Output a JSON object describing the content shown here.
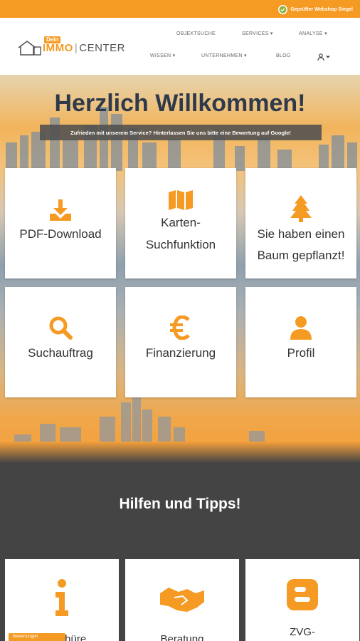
{
  "topbar": {
    "seal_label": "Geprüfter Webshop Siegel"
  },
  "logo": {
    "dein": "Dein",
    "immo": "IMMO",
    "center": "CENTER"
  },
  "nav": {
    "objektsuche": "OBJEKTSUCHE",
    "services": "SERVICES",
    "analyse": "ANALYSE",
    "wissen": "WISSEN",
    "unternehmen": "UNTERNEHMEN",
    "blog": "BLOG"
  },
  "hero": {
    "title": "Herzlich Willkommen!",
    "banner": "Zufrieden mit unserem Service? Hinterlassen Sie uns bitte eine Bewertung auf Google!"
  },
  "tiles": [
    {
      "line1": "PDF-Download",
      "line2": "",
      "icon": "download-icon"
    },
    {
      "line1": "Karten-",
      "line2": "Suchfunktion",
      "icon": "map-icon"
    },
    {
      "line1": "Sie haben einen",
      "line2": "Baum gepflanzt!",
      "icon": "tree-icon"
    },
    {
      "line1": "Suchauftrag",
      "line2": "",
      "icon": "search-icon"
    },
    {
      "line1": "Finanzierung",
      "line2": "",
      "icon": "euro-icon"
    },
    {
      "line1": "Profil",
      "line2": "",
      "icon": "user-icon"
    }
  ],
  "help": {
    "title": "Hilfen und Tipps!",
    "cards": [
      {
        "label": "Broschüre",
        "icon": "info-icon"
      },
      {
        "label": "Beratung",
        "icon": "handshake-icon"
      },
      {
        "label": "ZVG-",
        "icon": "blogger-icon"
      }
    ],
    "tab_label": "Bewertungen"
  },
  "colors": {
    "accent": "#f59a23",
    "dark": "#444444",
    "title": "#2e3a4b"
  }
}
